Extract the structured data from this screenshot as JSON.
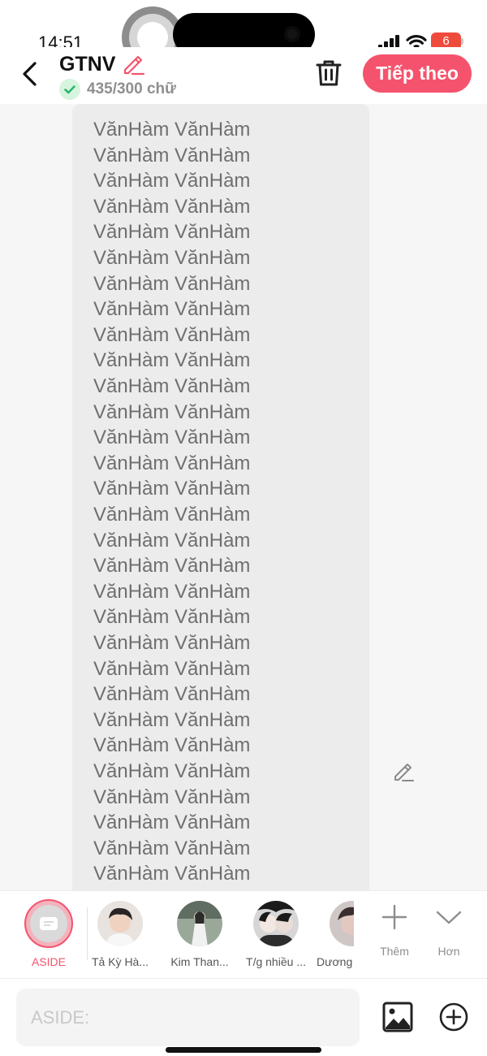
{
  "status_bar": {
    "time": "14:51",
    "battery_level": "6",
    "battery_color": "#ef4b3c"
  },
  "header": {
    "title": "GTNV",
    "word_count": "435/300 chữ",
    "next_label": "Tiếp theo",
    "accent_color": "#f5536d"
  },
  "content": {
    "lines": [
      "VănHàm VănHàm",
      "VănHàm VănHàm",
      "VănHàm VănHàm",
      "VănHàm VănHàm",
      "VănHàm VănHàm",
      "VănHàm VănHàm",
      "VănHàm VănHàm",
      "VănHàm VănHàm",
      "VănHàm VănHàm",
      "VănHàm VănHàm",
      "VănHàm VănHàm",
      "VănHàm VănHàm",
      "VănHàm VănHàm",
      "VănHàm VănHàm",
      "VănHàm VănHàm",
      "VănHàm VănHàm",
      "VănHàm VănHàm",
      "VănHàm VănHàm",
      "VănHàm VănHàm",
      "VănHàm VănHàm",
      "VănHàm VănHàm",
      "VănHàm VănHàm",
      "VănHàm VănHàm",
      "VănHàm VănHàm",
      "VănHàm VănHàm",
      "VănHàm VănHàm",
      "VănHàm VănHàm",
      "VănHàm VănHàm",
      "VănHàm VănHàm",
      "VănHàm VănHàm",
      "VănHàm VănHàm"
    ]
  },
  "characters": {
    "aside_label": "ASIDE",
    "items": [
      {
        "name": "Tả Kỳ Hà..."
      },
      {
        "name": "Kim Than..."
      },
      {
        "name": "T/g nhiều ..."
      },
      {
        "name": "Dương"
      }
    ],
    "more_label": "Thêm",
    "expand_label": "Hơn"
  },
  "input": {
    "placeholder": "ASIDE:"
  }
}
